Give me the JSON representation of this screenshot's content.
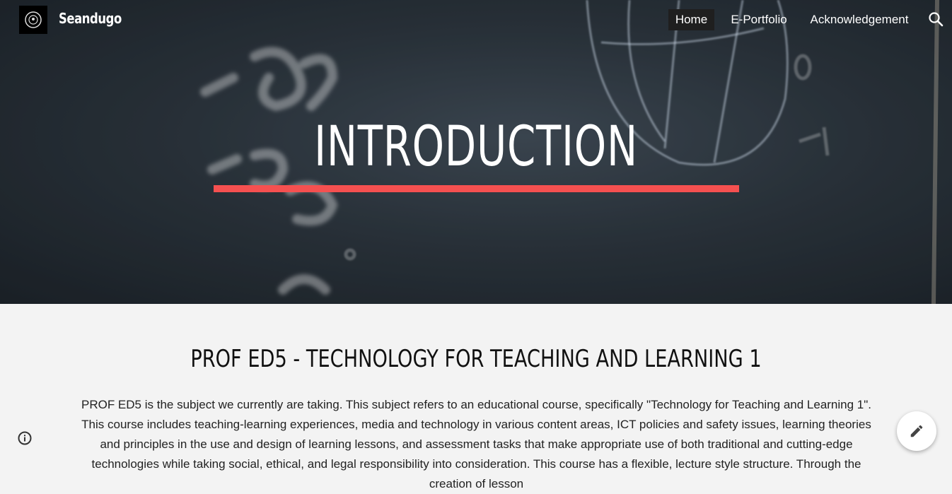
{
  "header": {
    "site_title": "Seandugo",
    "nav": [
      {
        "label": "Home",
        "active": true
      },
      {
        "label": "E-Portfolio",
        "active": false
      },
      {
        "label": "Acknowledgement",
        "active": false
      }
    ],
    "search_icon": "search-icon"
  },
  "hero": {
    "title": "INTRODUCTION",
    "underline_color": "#f55050",
    "chalk_marks": [
      "-52",
      "-38",
      "-38",
      "38",
      "-10",
      "0"
    ]
  },
  "main": {
    "section_title": "PROF ED5 - TECHNOLOGY FOR TEACHING AND LEARNING 1",
    "paragraph": "PROF ED5  is the subject we currently are taking. This subject refers to an educational course, specifically \"Technology for Teaching and Learning 1\". This course includes teaching-learning experiences, media and technology in various content areas, ICT policies and safety issues, learning theories and principles in the use and design of learning lessons, and assessment tasks that make appropriate use of both traditional and cutting-edge technologies while taking social, ethical, and legal responsibility into consideration. This course has a flexible, lecture style structure. Through the creation of lesson"
  },
  "controls": {
    "info_icon": "info-icon",
    "edit_icon": "pencil-icon"
  }
}
